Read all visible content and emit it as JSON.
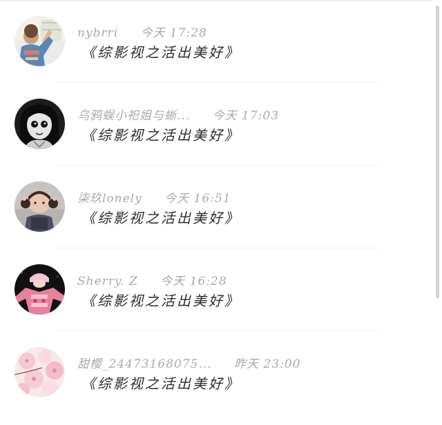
{
  "comments": [
    {
      "name": "nybrri",
      "time": "今天 17:28",
      "text": "《综影视之活出美好》",
      "avatar_icon": "girl-photo-avatar-icon"
    },
    {
      "name": "乌鸦蜈小祀姐与蜥...",
      "time": "今天 17:03",
      "text": "《综影视之活出美好》",
      "avatar_icon": "doll-face-avatar-icon"
    },
    {
      "name": "柒玖lonely",
      "time": "今天 16:51",
      "text": "《综影视之活出美好》",
      "avatar_icon": "child-pigtails-avatar-icon"
    },
    {
      "name": "Sherry. Z",
      "time": "今天 16:28",
      "text": "《综影视之活出美好》",
      "avatar_icon": "pink-sweater-avatar-icon"
    },
    {
      "name": "甜樱_24473168075...",
      "time": "昨天 23:00",
      "text": "《综影视之活出美好》",
      "avatar_icon": "cherry-blossom-avatar-icon"
    }
  ],
  "colors": {
    "meta": "#a9a9a9",
    "message": "#2a2a2a",
    "divider": "#f0f0f0",
    "scrollbar": "#d4d4d4"
  }
}
